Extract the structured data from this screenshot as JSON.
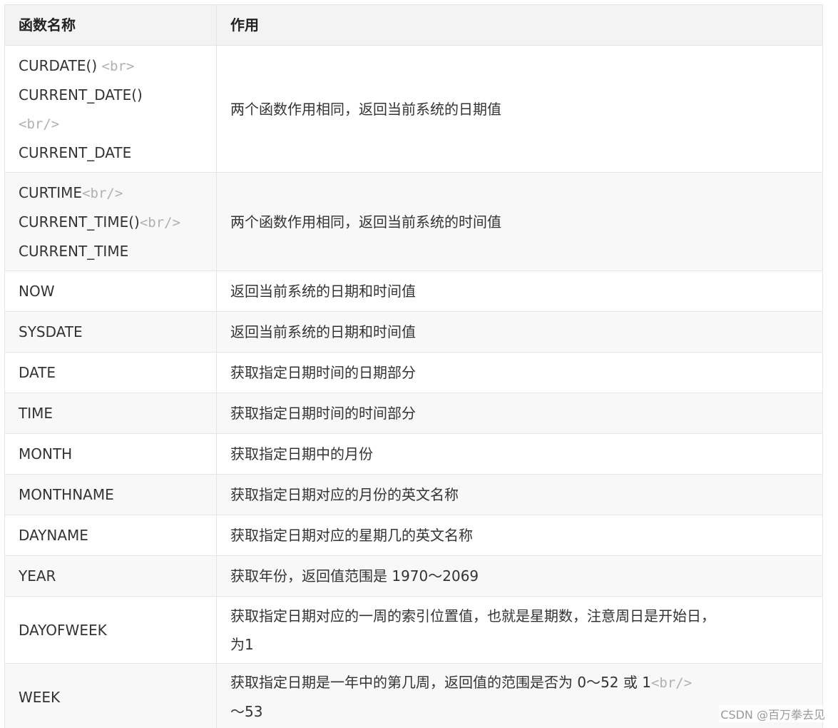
{
  "table": {
    "headers": {
      "name": "函数名称",
      "effect": "作用"
    },
    "rows": [
      {
        "name_parts": [
          {
            "text": "CURDATE() ",
            "tag": "<br>"
          },
          {
            "text": "CURRENT_DATE()",
            "tag": ""
          },
          {
            "text": "",
            "tag": "<br/>"
          },
          {
            "text": "CURRENT_DATE",
            "tag": ""
          }
        ],
        "effect": "两个函数作用相同，返回当前系统的日期值"
      },
      {
        "name_parts": [
          {
            "text": "CURTIME",
            "tag": "<br/>"
          },
          {
            "text": "CURRENT_TIME()",
            "tag": "<br/>"
          },
          {
            "text": "CURRENT_TIME",
            "tag": ""
          }
        ],
        "effect": "两个函数作用相同，返回当前系统的时间值"
      },
      {
        "name": "NOW",
        "effect": "返回当前系统的日期和时间值"
      },
      {
        "name": "SYSDATE",
        "effect": "返回当前系统的日期和时间值"
      },
      {
        "name": "DATE",
        "effect": "获取指定日期时间的日期部分"
      },
      {
        "name": "TIME",
        "effect": "获取指定日期时间的时间部分"
      },
      {
        "name": "MONTH",
        "effect": "获取指定日期中的月份"
      },
      {
        "name": "MONTHNAME",
        "effect": "获取指定日期对应的月份的英文名称"
      },
      {
        "name": "DAYNAME",
        "effect": "获取指定日期对应的星期几的英文名称"
      },
      {
        "name": "YEAR",
        "effect": "获取年份，返回值范围是 1970〜2069"
      },
      {
        "name": "DAYOFWEEK",
        "effect_lines": [
          {
            "text": "获取指定日期对应的一周的索引位置值，也就是星期数，注意周日是开始日，",
            "tag": ""
          },
          {
            "text": "为1",
            "tag": ""
          }
        ]
      },
      {
        "name": "WEEK",
        "effect_lines": [
          {
            "text": "获取指定日期是一年中的第几周，返回值的范围是否为 0〜52 或 1",
            "tag": "<br/>"
          },
          {
            "text": "〜53",
            "tag": ""
          }
        ]
      }
    ]
  },
  "watermark": "CSDN @百万拳去见"
}
